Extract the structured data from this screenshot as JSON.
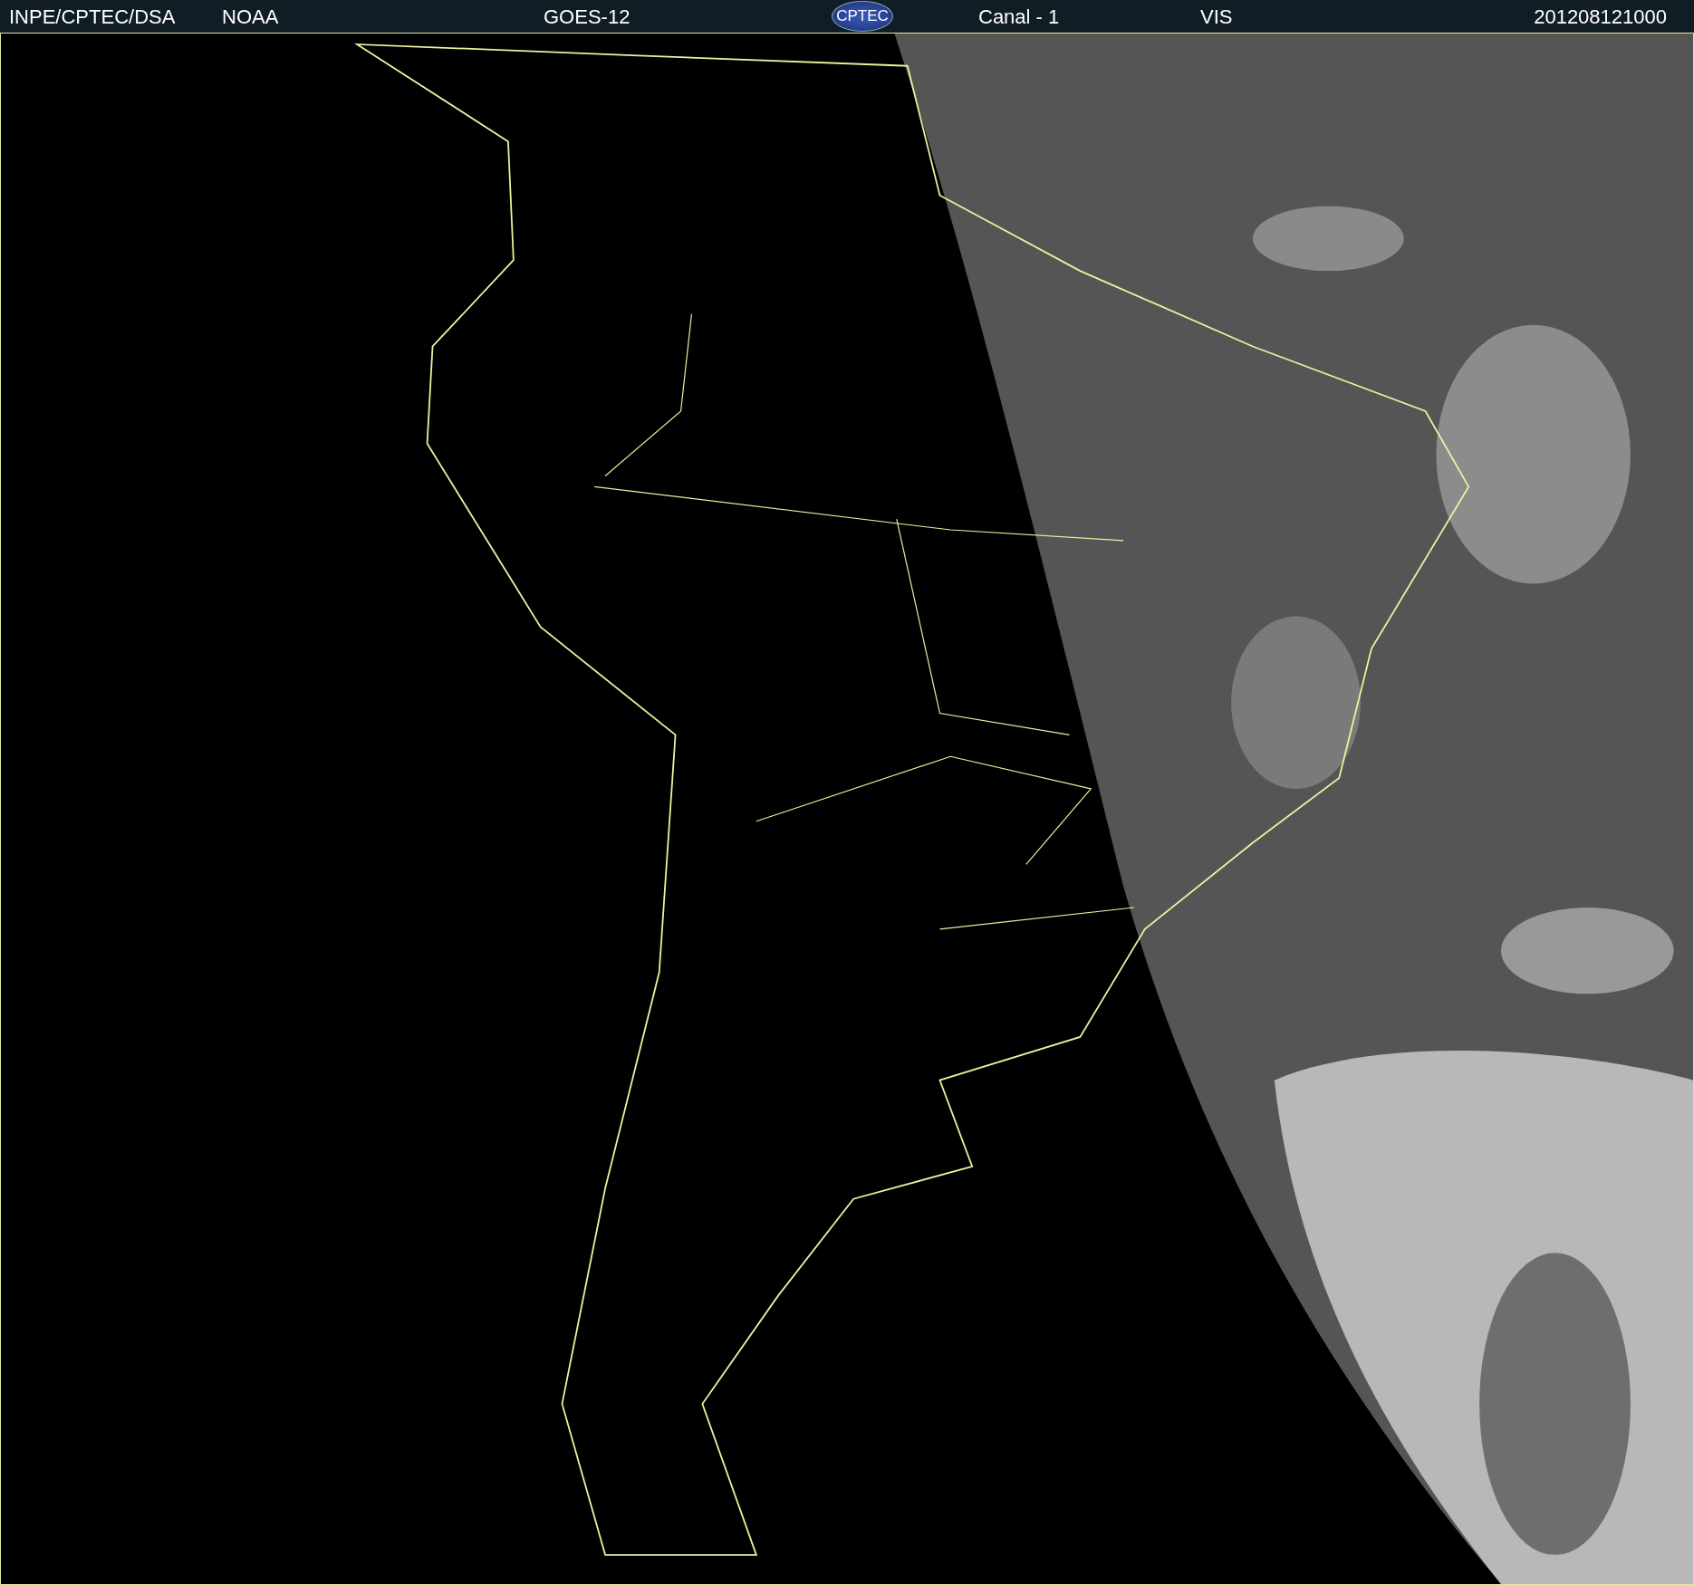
{
  "header": {
    "labels": [
      {
        "text": "INPE/CPTEC/DSA"
      },
      {
        "text": "NOAA"
      },
      {
        "text": "GOES-12"
      },
      {
        "kind": "logo",
        "text": "CPTEC"
      },
      {
        "text": "Canal - 1"
      },
      {
        "text": "VIS"
      },
      {
        "text": "201208121000"
      }
    ]
  }
}
